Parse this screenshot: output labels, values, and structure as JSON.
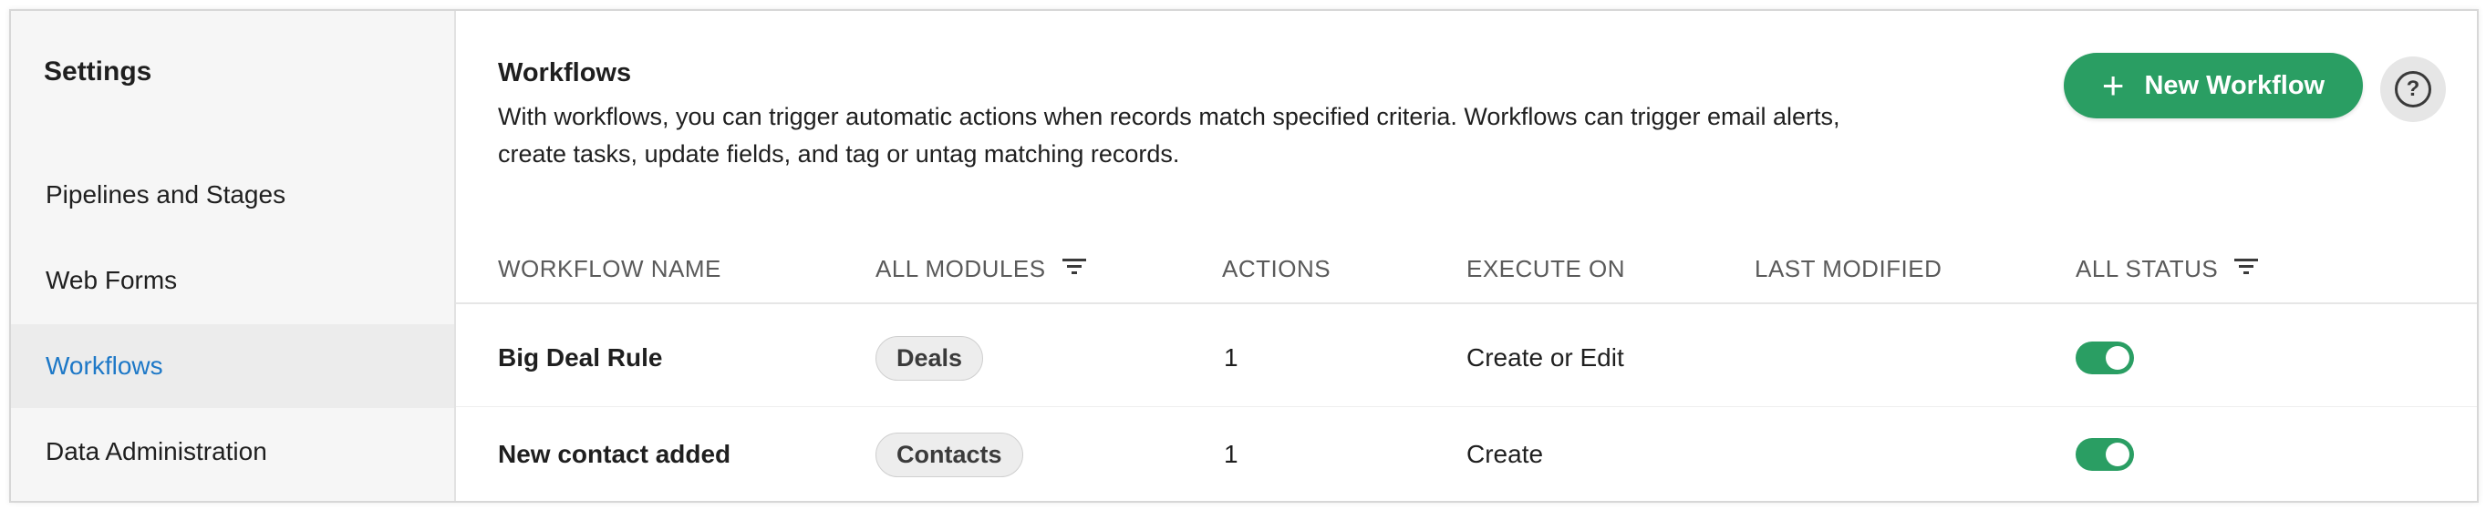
{
  "sidebar": {
    "title": "Settings",
    "items": [
      {
        "label": "Pipelines and Stages"
      },
      {
        "label": "Web Forms"
      },
      {
        "label": "Workflows"
      },
      {
        "label": "Data Administration"
      }
    ]
  },
  "main": {
    "title": "Workflows",
    "description": "With workflows, you can trigger automatic actions when records match specified criteria. Workflows can trigger email alerts, create tasks, update fields, and tag or untag matching records.",
    "new_button_label": "New Workflow",
    "help_icon": "question-circle-icon"
  },
  "table": {
    "columns": [
      "WORKFLOW NAME",
      "ALL MODULES",
      "ACTIONS",
      "EXECUTE ON",
      "LAST MODIFIED",
      "ALL STATUS"
    ],
    "rows": [
      {
        "name": "Big Deal Rule",
        "module": "Deals",
        "actions": "1",
        "execute_on": "Create or Edit",
        "last_modified": "",
        "status": "on"
      },
      {
        "name": "New contact added",
        "module": "Contacts",
        "actions": "1",
        "execute_on": "Create",
        "last_modified": "",
        "status": "on"
      }
    ]
  },
  "colors": {
    "accent_green": "#2a9e63",
    "active_link_blue": "#1d78c7",
    "sidebar_bg": "#f6f6f6"
  }
}
